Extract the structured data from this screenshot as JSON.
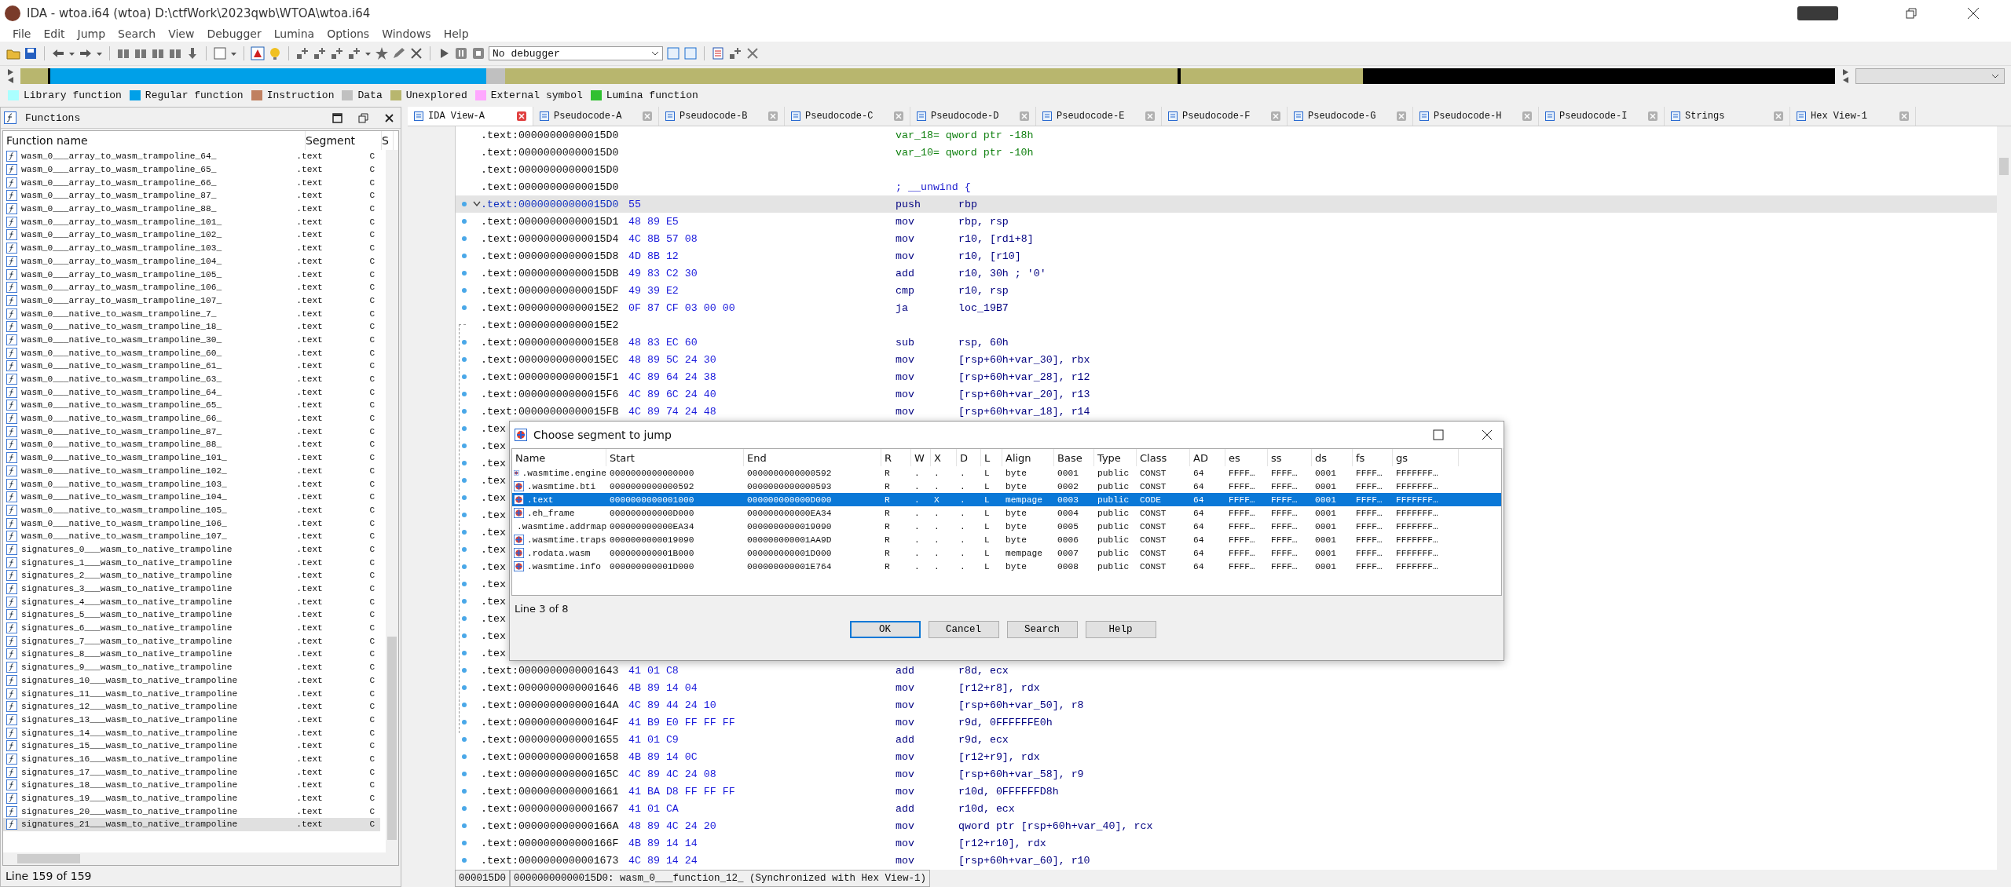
{
  "window": {
    "title": "IDA - wtoa.i64 (wtoa) D:\\ctfWork\\2023qwb\\WTOA\\wtoa.i64"
  },
  "menu": [
    "File",
    "Edit",
    "Jump",
    "Search",
    "View",
    "Debugger",
    "Lumina",
    "Options",
    "Windows",
    "Help"
  ],
  "toolbar": {
    "debugger_select": "No debugger"
  },
  "legend": [
    {
      "label": "Library function",
      "color": "#aaffff"
    },
    {
      "label": "Regular function",
      "color": "#00a0e8"
    },
    {
      "label": "Instruction",
      "color": "#c08060"
    },
    {
      "label": "Data",
      "color": "#c0c0c0"
    },
    {
      "label": "Unexplored",
      "color": "#b8b66e"
    },
    {
      "label": "External symbol",
      "color": "#ffa8ff"
    },
    {
      "label": "Lumina function",
      "color": "#30c030"
    }
  ],
  "functions": {
    "title": "Functions",
    "columns": [
      "Function name",
      "Segment",
      "S"
    ],
    "rows": [
      {
        "name": "wasm_0___array_to_wasm_trampoline_64_",
        "segment": ".text",
        "column_3": "C",
        "selected": false
      },
      {
        "name": "wasm_0___array_to_wasm_trampoline_65_",
        "segment": ".text",
        "column_3": "C",
        "selected": false
      },
      {
        "name": "wasm_0___array_to_wasm_trampoline_66_",
        "segment": ".text",
        "column_3": "C",
        "selected": false
      },
      {
        "name": "wasm_0___array_to_wasm_trampoline_87_",
        "segment": ".text",
        "column_3": "C",
        "selected": false
      },
      {
        "name": "wasm_0___array_to_wasm_trampoline_88_",
        "segment": ".text",
        "column_3": "C",
        "selected": false
      },
      {
        "name": "wasm_0___array_to_wasm_trampoline_101_",
        "segment": ".text",
        "column_3": "C",
        "selected": false
      },
      {
        "name": "wasm_0___array_to_wasm_trampoline_102_",
        "segment": ".text",
        "column_3": "C",
        "selected": false
      },
      {
        "name": "wasm_0___array_to_wasm_trampoline_103_",
        "segment": ".text",
        "column_3": "C",
        "selected": false
      },
      {
        "name": "wasm_0___array_to_wasm_trampoline_104_",
        "segment": ".text",
        "column_3": "C",
        "selected": false
      },
      {
        "name": "wasm_0___array_to_wasm_trampoline_105_",
        "segment": ".text",
        "column_3": "C",
        "selected": false
      },
      {
        "name": "wasm_0___array_to_wasm_trampoline_106_",
        "segment": ".text",
        "column_3": "C",
        "selected": false
      },
      {
        "name": "wasm_0___array_to_wasm_trampoline_107_",
        "segment": ".text",
        "column_3": "C",
        "selected": false
      },
      {
        "name": "wasm_0___native_to_wasm_trampoline_7_",
        "segment": ".text",
        "column_3": "C",
        "selected": false
      },
      {
        "name": "wasm_0___native_to_wasm_trampoline_18_",
        "segment": ".text",
        "column_3": "C",
        "selected": false
      },
      {
        "name": "wasm_0___native_to_wasm_trampoline_30_",
        "segment": ".text",
        "column_3": "C",
        "selected": false
      },
      {
        "name": "wasm_0___native_to_wasm_trampoline_60_",
        "segment": ".text",
        "column_3": "C",
        "selected": false
      },
      {
        "name": "wasm_0___native_to_wasm_trampoline_61_",
        "segment": ".text",
        "column_3": "C",
        "selected": false
      },
      {
        "name": "wasm_0___native_to_wasm_trampoline_63_",
        "segment": ".text",
        "column_3": "C",
        "selected": false
      },
      {
        "name": "wasm_0___native_to_wasm_trampoline_64_",
        "segment": ".text",
        "column_3": "C",
        "selected": false
      },
      {
        "name": "wasm_0___native_to_wasm_trampoline_65_",
        "segment": ".text",
        "column_3": "C",
        "selected": false
      },
      {
        "name": "wasm_0___native_to_wasm_trampoline_66_",
        "segment": ".text",
        "column_3": "C",
        "selected": false
      },
      {
        "name": "wasm_0___native_to_wasm_trampoline_87_",
        "segment": ".text",
        "column_3": "C",
        "selected": false
      },
      {
        "name": "wasm_0___native_to_wasm_trampoline_88_",
        "segment": ".text",
        "column_3": "C",
        "selected": false
      },
      {
        "name": "wasm_0___native_to_wasm_trampoline_101_",
        "segment": ".text",
        "column_3": "C",
        "selected": false
      },
      {
        "name": "wasm_0___native_to_wasm_trampoline_102_",
        "segment": ".text",
        "column_3": "C",
        "selected": false
      },
      {
        "name": "wasm_0___native_to_wasm_trampoline_103_",
        "segment": ".text",
        "column_3": "C",
        "selected": false
      },
      {
        "name": "wasm_0___native_to_wasm_trampoline_104_",
        "segment": ".text",
        "column_3": "C",
        "selected": false
      },
      {
        "name": "wasm_0___native_to_wasm_trampoline_105_",
        "segment": ".text",
        "column_3": "C",
        "selected": false
      },
      {
        "name": "wasm_0___native_to_wasm_trampoline_106_",
        "segment": ".text",
        "column_3": "C",
        "selected": false
      },
      {
        "name": "wasm_0___native_to_wasm_trampoline_107_",
        "segment": ".text",
        "column_3": "C",
        "selected": false
      },
      {
        "name": "signatures_0___wasm_to_native_trampoline",
        "segment": ".text",
        "column_3": "C",
        "selected": false
      },
      {
        "name": "signatures_1___wasm_to_native_trampoline",
        "segment": ".text",
        "column_3": "C",
        "selected": false
      },
      {
        "name": "signatures_2___wasm_to_native_trampoline",
        "segment": ".text",
        "column_3": "C",
        "selected": false
      },
      {
        "name": "signatures_3___wasm_to_native_trampoline",
        "segment": ".text",
        "column_3": "C",
        "selected": false
      },
      {
        "name": "signatures_4___wasm_to_native_trampoline",
        "segment": ".text",
        "column_3": "C",
        "selected": false
      },
      {
        "name": "signatures_5___wasm_to_native_trampoline",
        "segment": ".text",
        "column_3": "C",
        "selected": false
      },
      {
        "name": "signatures_6___wasm_to_native_trampoline",
        "segment": ".text",
        "column_3": "C",
        "selected": false
      },
      {
        "name": "signatures_7___wasm_to_native_trampoline",
        "segment": ".text",
        "column_3": "C",
        "selected": false
      },
      {
        "name": "signatures_8___wasm_to_native_trampoline",
        "segment": ".text",
        "column_3": "C",
        "selected": false
      },
      {
        "name": "signatures_9___wasm_to_native_trampoline",
        "segment": ".text",
        "column_3": "C",
        "selected": false
      },
      {
        "name": "signatures_10___wasm_to_native_trampoline",
        "segment": ".text",
        "column_3": "C",
        "selected": false
      },
      {
        "name": "signatures_11___wasm_to_native_trampoline",
        "segment": ".text",
        "column_3": "C",
        "selected": false
      },
      {
        "name": "signatures_12___wasm_to_native_trampoline",
        "segment": ".text",
        "column_3": "C",
        "selected": false
      },
      {
        "name": "signatures_13___wasm_to_native_trampoline",
        "segment": ".text",
        "column_3": "C",
        "selected": false
      },
      {
        "name": "signatures_14___wasm_to_native_trampoline",
        "segment": ".text",
        "column_3": "C",
        "selected": false
      },
      {
        "name": "signatures_15___wasm_to_native_trampoline",
        "segment": ".text",
        "column_3": "C",
        "selected": false
      },
      {
        "name": "signatures_16___wasm_to_native_trampoline",
        "segment": ".text",
        "column_3": "C",
        "selected": false
      },
      {
        "name": "signatures_17___wasm_to_native_trampoline",
        "segment": ".text",
        "column_3": "C",
        "selected": false
      },
      {
        "name": "signatures_18___wasm_to_native_trampoline",
        "segment": ".text",
        "column_3": "C",
        "selected": false
      },
      {
        "name": "signatures_19___wasm_to_native_trampoline",
        "segment": ".text",
        "column_3": "C",
        "selected": false
      },
      {
        "name": "signatures_20___wasm_to_native_trampoline",
        "segment": ".text",
        "column_3": "C",
        "selected": false
      },
      {
        "name": "signatures_21___wasm_to_native_trampoline",
        "segment": ".text",
        "column_3": "C",
        "selected": true
      }
    ],
    "status": "Line 159 of 159"
  },
  "tabs": [
    {
      "label": "IDA View-A",
      "selected": true
    },
    {
      "label": "Pseudocode-A",
      "selected": false
    },
    {
      "label": "Pseudocode-B",
      "selected": false
    },
    {
      "label": "Pseudocode-C",
      "selected": false
    },
    {
      "label": "Pseudocode-D",
      "selected": false
    },
    {
      "label": "Pseudocode-E",
      "selected": false
    },
    {
      "label": "Pseudocode-F",
      "selected": false
    },
    {
      "label": "Pseudocode-G",
      "selected": false
    },
    {
      "label": "Pseudocode-H",
      "selected": false
    },
    {
      "label": "Pseudocode-I",
      "selected": false
    },
    {
      "label": "Strings",
      "selected": false
    },
    {
      "label": "Hex View-1",
      "selected": false
    }
  ],
  "listing": [
    {
      "kind": "stackvar",
      "addr": ".text:00000000000015D0",
      "text": "var_18= qword ptr -18h",
      "dot": false,
      "selected": false
    },
    {
      "kind": "stackvar",
      "addr": ".text:00000000000015D0",
      "text": "var_10= qword ptr -10h",
      "dot": false,
      "selected": false
    },
    {
      "kind": "blank",
      "addr": ".text:00000000000015D0",
      "dot": false,
      "selected": false
    },
    {
      "kind": "comment",
      "addr": ".text:00000000000015D0",
      "text": "; __unwind {",
      "dot": false,
      "selected": false
    },
    {
      "kind": "insn",
      "addr": ".text:00000000000015D0",
      "bytes": "55",
      "op": "push",
      "args": "rbp",
      "dot": true,
      "fold": true,
      "selected": true
    },
    {
      "kind": "insn",
      "addr": ".text:00000000000015D1",
      "bytes": "48 89 E5",
      "op": "mov",
      "args": "rbp, rsp",
      "dot": true,
      "selected": false
    },
    {
      "kind": "insn",
      "addr": ".text:00000000000015D4",
      "bytes": "4C 8B 57 08",
      "op": "mov",
      "args": "r10, [rdi+8]",
      "dot": true,
      "selected": false
    },
    {
      "kind": "insn",
      "addr": ".text:00000000000015D8",
      "bytes": "4D 8B 12",
      "op": "mov",
      "args": "r10, [r10]",
      "dot": true,
      "selected": false
    },
    {
      "kind": "insn",
      "addr": ".text:00000000000015DB",
      "bytes": "49 83 C2 30",
      "op": "add",
      "args": "r10, 30h ; '0'",
      "dot": true,
      "selected": false
    },
    {
      "kind": "insn",
      "addr": ".text:00000000000015DF",
      "bytes": "49 39 E2",
      "op": "cmp",
      "args": "r10, rsp",
      "dot": true,
      "selected": false
    },
    {
      "kind": "insn",
      "addr": ".text:00000000000015E2",
      "bytes": "0F 87 CF 03 00 00",
      "op": "ja",
      "args": "loc_19B7",
      "dot": true,
      "selected": false
    },
    {
      "kind": "blank",
      "addr": ".text:00000000000015E2",
      "dot": false,
      "selected": false
    },
    {
      "kind": "insn",
      "addr": ".text:00000000000015E8",
      "bytes": "48 83 EC 60",
      "op": "sub",
      "args": "rsp, 60h",
      "dot": true,
      "selected": false
    },
    {
      "kind": "insn",
      "addr": ".text:00000000000015EC",
      "bytes": "48 89 5C 24 30",
      "op": "mov",
      "args": "[rsp+60h+var_30], rbx",
      "dot": true,
      "selected": false
    },
    {
      "kind": "insn",
      "addr": ".text:00000000000015F1",
      "bytes": "4C 89 64 24 38",
      "op": "mov",
      "args": "[rsp+60h+var_28], r12",
      "dot": true,
      "selected": false
    },
    {
      "kind": "insn",
      "addr": ".text:00000000000015F6",
      "bytes": "4C 89 6C 24 40",
      "op": "mov",
      "args": "[rsp+60h+var_20], r13",
      "dot": true,
      "selected": false
    },
    {
      "kind": "insn",
      "addr": ".text:00000000000015FB",
      "bytes": "4C 89 74 24 48",
      "op": "mov",
      "args": "[rsp+60h+var_18], r14",
      "dot": true,
      "selected": false
    },
    {
      "kind": "covered",
      "addr": ".tex",
      "dot": true,
      "selected": false
    },
    {
      "kind": "covered",
      "addr": ".tex",
      "dot": true,
      "selected": false
    },
    {
      "kind": "covered",
      "addr": ".tex",
      "dot": true,
      "selected": false
    },
    {
      "kind": "covered",
      "addr": ".tex",
      "dot": true,
      "selected": false
    },
    {
      "kind": "covered",
      "addr": ".tex",
      "dot": true,
      "selected": false
    },
    {
      "kind": "covered",
      "addr": ".tex",
      "dot": true,
      "selected": false
    },
    {
      "kind": "covered",
      "addr": ".tex",
      "dot": true,
      "selected": false
    },
    {
      "kind": "covered",
      "addr": ".tex",
      "dot": true,
      "selected": false
    },
    {
      "kind": "covered",
      "addr": ".tex",
      "dot": true,
      "selected": false
    },
    {
      "kind": "covered",
      "addr": ".tex",
      "dot": true,
      "selected": false
    },
    {
      "kind": "covered",
      "addr": ".tex",
      "dot": true,
      "selected": false
    },
    {
      "kind": "covered",
      "addr": ".tex",
      "dot": true,
      "selected": false
    },
    {
      "kind": "covered",
      "addr": ".tex",
      "dot": true,
      "selected": false
    },
    {
      "kind": "covered",
      "addr": ".tex",
      "dot": true,
      "selected": false
    },
    {
      "kind": "insn",
      "addr": ".text:0000000000001643",
      "bytes": "41 01 C8",
      "op": "add",
      "args": "r8d, ecx",
      "dot": true,
      "selected": false
    },
    {
      "kind": "insn",
      "addr": ".text:0000000000001646",
      "bytes": "4B 89 14 04",
      "op": "mov",
      "args": "[r12+r8], rdx",
      "dot": true,
      "selected": false
    },
    {
      "kind": "insn",
      "addr": ".text:000000000000164A",
      "bytes": "4C 89 44 24 10",
      "op": "mov",
      "args": "[rsp+60h+var_50], r8",
      "dot": true,
      "selected": false
    },
    {
      "kind": "insn",
      "addr": ".text:000000000000164F",
      "bytes": "41 B9 E0 FF FF FF",
      "op": "mov",
      "args": "r9d, 0FFFFFFE0h",
      "dot": true,
      "selected": false
    },
    {
      "kind": "insn",
      "addr": ".text:0000000000001655",
      "bytes": "41 01 C9",
      "op": "add",
      "args": "r9d, ecx",
      "dot": true,
      "selected": false
    },
    {
      "kind": "insn",
      "addr": ".text:0000000000001658",
      "bytes": "4B 89 14 0C",
      "op": "mov",
      "args": "[r12+r9], rdx",
      "dot": true,
      "selected": false
    },
    {
      "kind": "insn",
      "addr": ".text:000000000000165C",
      "bytes": "4C 89 4C 24 08",
      "op": "mov",
      "args": "[rsp+60h+var_58], r9",
      "dot": true,
      "selected": false
    },
    {
      "kind": "insn",
      "addr": ".text:0000000000001661",
      "bytes": "41 BA D8 FF FF FF",
      "op": "mov",
      "args": "r10d, 0FFFFFFD8h",
      "dot": true,
      "selected": false
    },
    {
      "kind": "insn",
      "addr": ".text:0000000000001667",
      "bytes": "41 01 CA",
      "op": "add",
      "args": "r10d, ecx",
      "dot": true,
      "selected": false
    },
    {
      "kind": "insn",
      "addr": ".text:000000000000166A",
      "bytes": "48 89 4C 24 20",
      "op": "mov",
      "args": "qword ptr [rsp+60h+var_40], rcx",
      "dot": true,
      "selected": false
    },
    {
      "kind": "insn",
      "addr": ".text:000000000000166F",
      "bytes": "4B 89 14 14",
      "op": "mov",
      "args": "[r12+r10], rdx",
      "dot": true,
      "selected": false
    },
    {
      "kind": "insn",
      "addr": ".text:0000000000001673",
      "bytes": "4C 89 14 24",
      "op": "mov",
      "args": "[rsp+60h+var_60], r10",
      "dot": true,
      "selected": false
    }
  ],
  "status_bar": [
    "000015D0",
    "00000000000015D0: wasm_0___function_12_ (Synchronized with Hex View-1)"
  ],
  "dialog": {
    "title": "Choose segment to jump",
    "columns": [
      "Name",
      "Start",
      "End",
      "R",
      "W",
      "X",
      "D",
      "L",
      "Align",
      "Base",
      "Type",
      "Class",
      "AD",
      "es",
      "ss",
      "ds",
      "fs",
      "gs"
    ],
    "rows": [
      {
        "cells": [
          ".wasmtime.engine",
          "0000000000000000",
          "0000000000000592",
          "R",
          ".",
          ".",
          ".",
          "L",
          "byte",
          "0001",
          "public",
          "CONST",
          "64",
          "FFFF…",
          "FFFF…",
          "0001",
          "FFFF…",
          "FFFFFFF…"
        ],
        "selected": false
      },
      {
        "cells": [
          ".wasmtime.bti",
          "0000000000000592",
          "0000000000000593",
          "R",
          ".",
          ".",
          ".",
          "L",
          "byte",
          "0002",
          "public",
          "CONST",
          "64",
          "FFFF…",
          "FFFF…",
          "0001",
          "FFFF…",
          "FFFFFFF…"
        ],
        "selected": false
      },
      {
        "cells": [
          ".text",
          "0000000000001000",
          "000000000000D000",
          "R",
          ".",
          "X",
          ".",
          "L",
          "mempage",
          "0003",
          "public",
          "CODE",
          "64",
          "FFFF…",
          "FFFF…",
          "0001",
          "FFFF…",
          "FFFFFFF…"
        ],
        "selected": true
      },
      {
        "cells": [
          ".eh_frame",
          "000000000000D000",
          "000000000000EA34",
          "R",
          ".",
          ".",
          ".",
          "L",
          "byte",
          "0004",
          "public",
          "CONST",
          "64",
          "FFFF…",
          "FFFF…",
          "0001",
          "FFFF…",
          "FFFFFFF…"
        ],
        "selected": false
      },
      {
        "cells": [
          ".wasmtime.addrmap",
          "000000000000EA34",
          "0000000000019090",
          "R",
          ".",
          ".",
          ".",
          "L",
          "byte",
          "0005",
          "public",
          "CONST",
          "64",
          "FFFF…",
          "FFFF…",
          "0001",
          "FFFF…",
          "FFFFFFF…"
        ],
        "selected": false
      },
      {
        "cells": [
          ".wasmtime.traps",
          "0000000000019090",
          "000000000001AA9D",
          "R",
          ".",
          ".",
          ".",
          "L",
          "byte",
          "0006",
          "public",
          "CONST",
          "64",
          "FFFF…",
          "FFFF…",
          "0001",
          "FFFF…",
          "FFFFFFF…"
        ],
        "selected": false
      },
      {
        "cells": [
          ".rodata.wasm",
          "000000000001B000",
          "000000000001D000",
          "R",
          ".",
          ".",
          ".",
          "L",
          "mempage",
          "0007",
          "public",
          "CONST",
          "64",
          "FFFF…",
          "FFFF…",
          "0001",
          "FFFF…",
          "FFFFFFF…"
        ],
        "selected": false
      },
      {
        "cells": [
          ".wasmtime.info",
          "000000000001D000",
          "000000000001E764",
          "R",
          ".",
          ".",
          ".",
          "L",
          "byte",
          "0008",
          "public",
          "CONST",
          "64",
          "FFFF…",
          "FFFF…",
          "0001",
          "FFFF…",
          "FFFFFFF…"
        ],
        "selected": false
      }
    ],
    "status": "Line 3 of 8",
    "buttons": [
      {
        "label": "OK",
        "default": true
      },
      {
        "label": "Cancel",
        "default": false
      },
      {
        "label": "Search",
        "default": false
      },
      {
        "label": "Help",
        "default": false
      }
    ]
  }
}
